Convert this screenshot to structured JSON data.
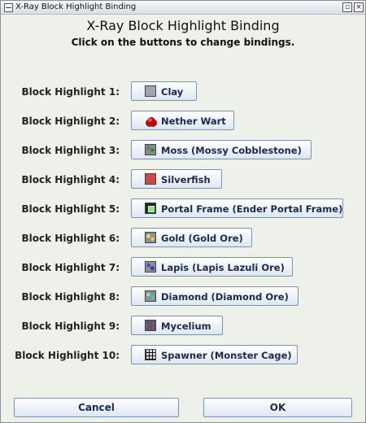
{
  "window": {
    "title": "X-Ray Block Highlight Binding",
    "controls": {
      "minimize": "▫",
      "close": "×"
    }
  },
  "header": {
    "title": "X-Ray Block Highlight Binding",
    "subtitle": "Click on the buttons to change bindings."
  },
  "bindings": [
    {
      "label": "Block Highlight 1:",
      "button_text": "Clay",
      "icon": "clay-block-icon"
    },
    {
      "label": "Block Highlight 2:",
      "button_text": "Nether Wart",
      "icon": "nether-wart-icon"
    },
    {
      "label": "Block Highlight 3:",
      "button_text": "Moss (Mossy Cobblestone)",
      "icon": "mossy-cobblestone-icon"
    },
    {
      "label": "Block Highlight 4:",
      "button_text": "Silverfish",
      "icon": "silverfish-block-icon"
    },
    {
      "label": "Block Highlight 5:",
      "button_text": "Portal Frame (Ender Portal Frame)",
      "icon": "ender-portal-frame-icon"
    },
    {
      "label": "Block Highlight 6:",
      "button_text": "Gold (Gold Ore)",
      "icon": "gold-ore-icon"
    },
    {
      "label": "Block Highlight 7:",
      "button_text": "Lapis (Lapis Lazuli Ore)",
      "icon": "lapis-ore-icon"
    },
    {
      "label": "Block Highlight 8:",
      "button_text": "Diamond (Diamond Ore)",
      "icon": "diamond-ore-icon"
    },
    {
      "label": "Block Highlight 9:",
      "button_text": "Mycelium",
      "icon": "mycelium-icon"
    },
    {
      "label": "Block Highlight 10:",
      "button_text": "Spawner (Monster Cage)",
      "icon": "monster-spawner-icon"
    }
  ],
  "footer": {
    "cancel_label": "Cancel",
    "ok_label": "OK"
  }
}
